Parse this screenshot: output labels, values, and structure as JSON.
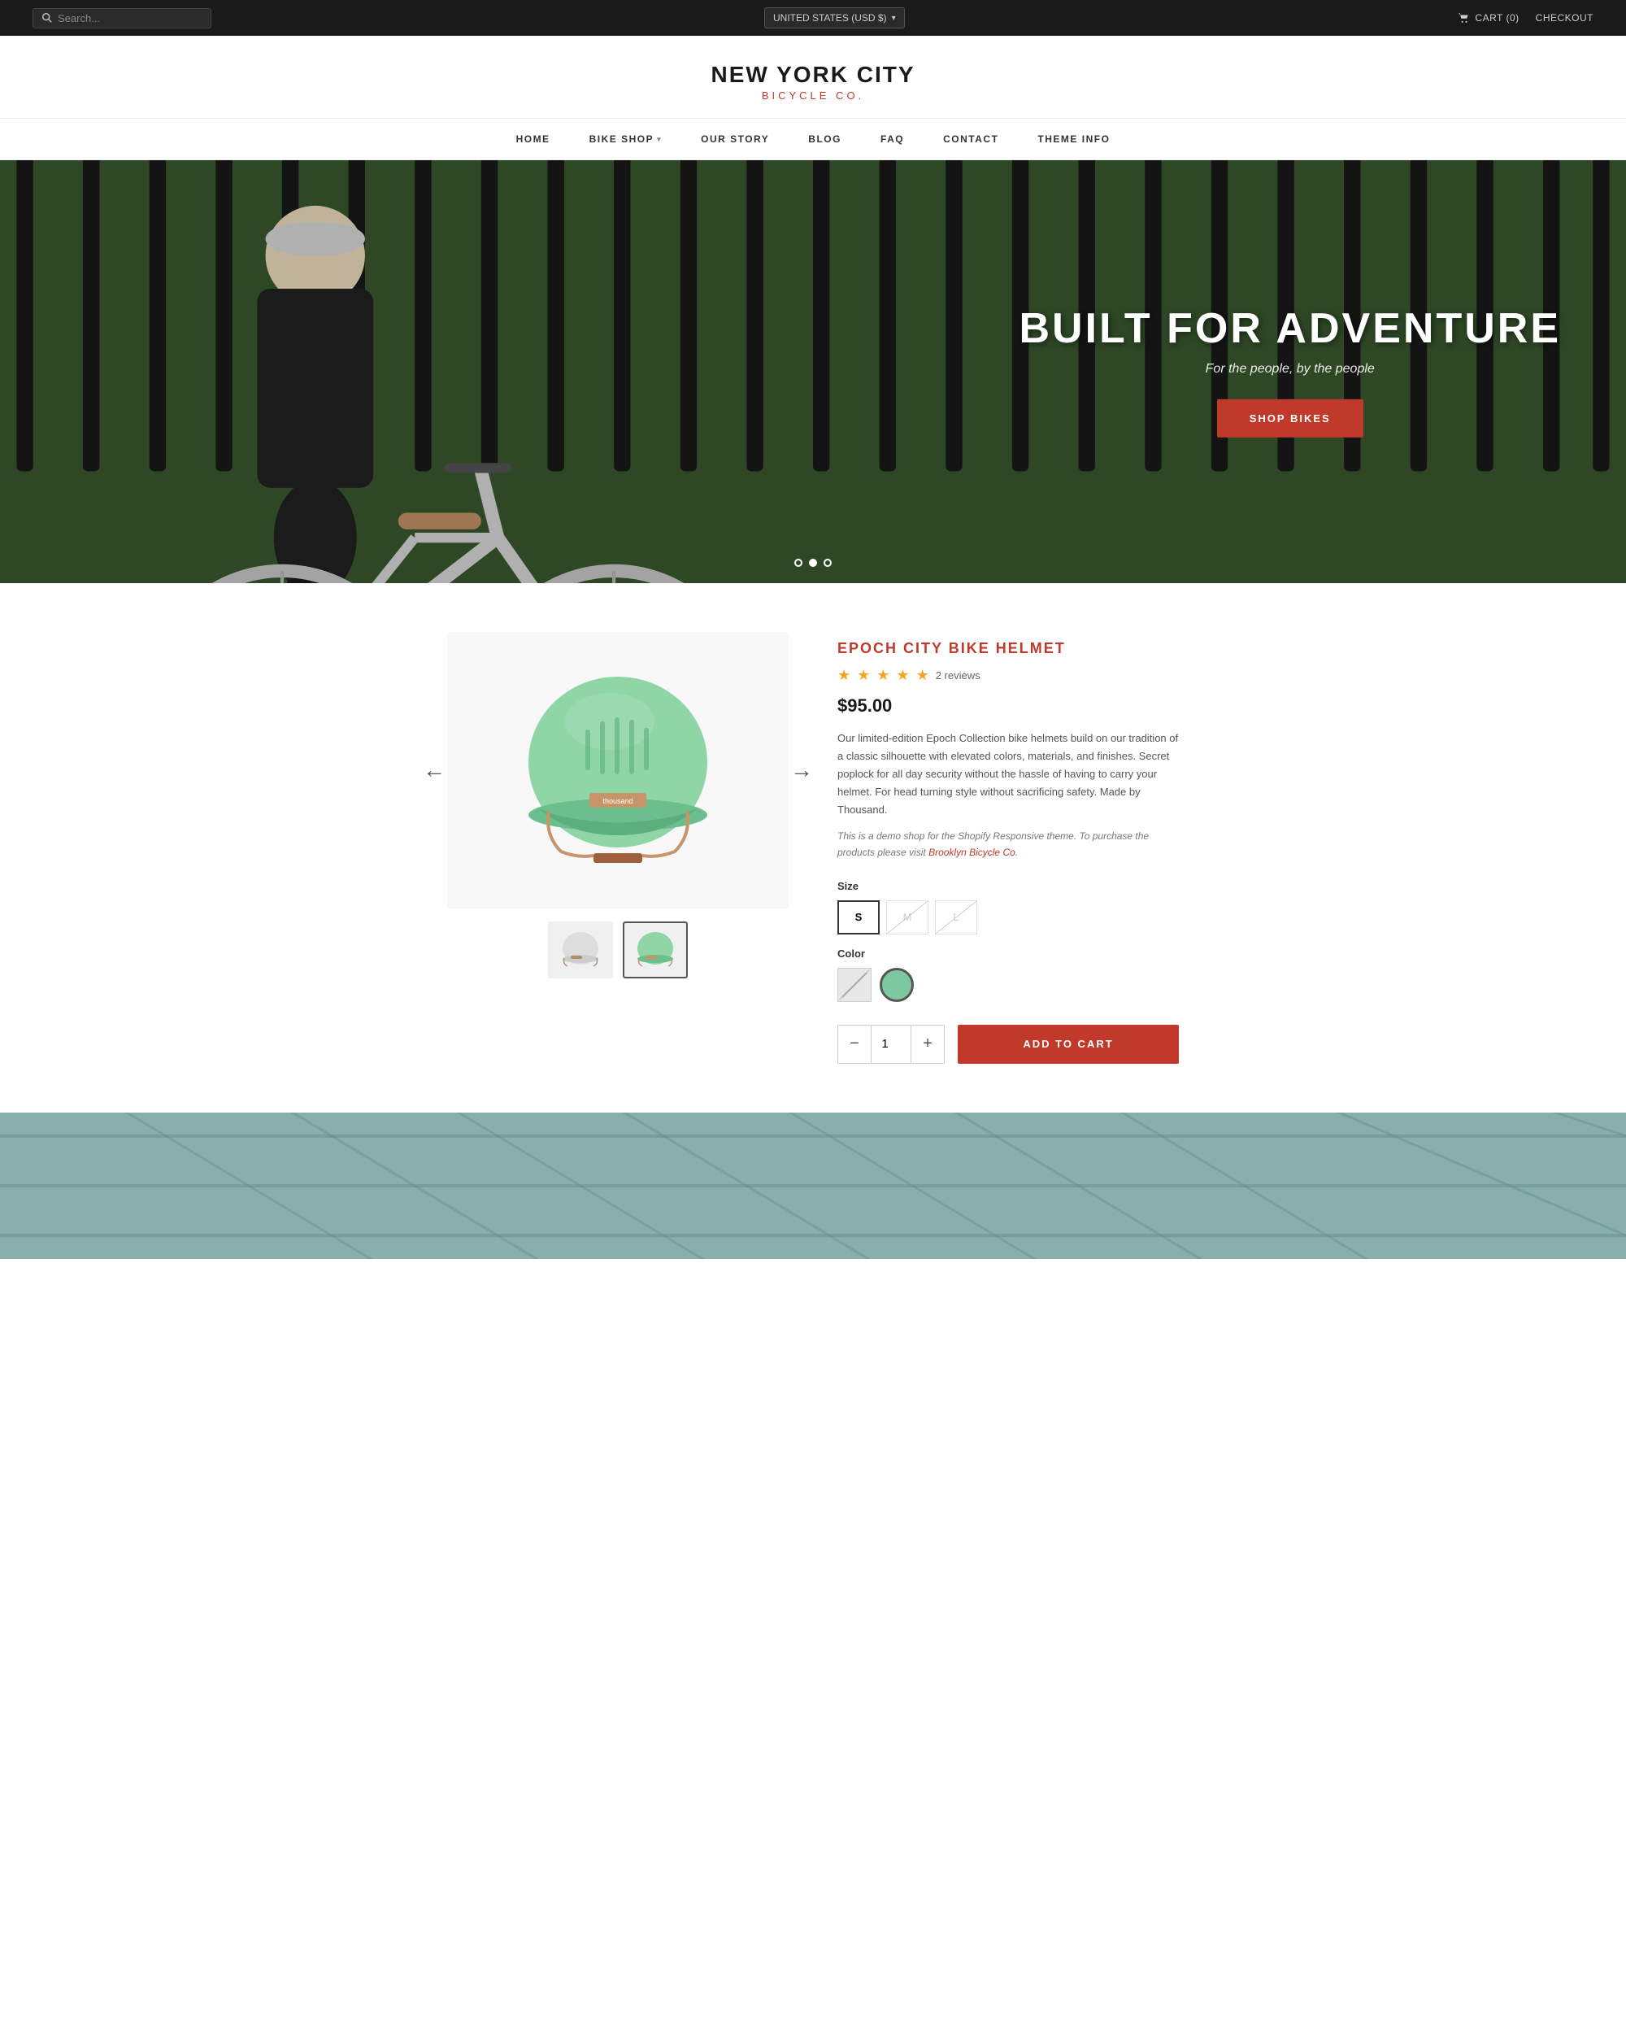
{
  "topbar": {
    "search_placeholder": "Search...",
    "currency": "UNITED STATES (USD $)",
    "cart_label": "CART (0)",
    "checkout_label": "CHECKOUT"
  },
  "header": {
    "brand_name": "NEW YORK CITY",
    "brand_sub": "BICYCLE CO."
  },
  "nav": {
    "items": [
      {
        "label": "HOME",
        "has_dropdown": false
      },
      {
        "label": "BIKE SHOP",
        "has_dropdown": true
      },
      {
        "label": "OUR STORY",
        "has_dropdown": false
      },
      {
        "label": "BLOG",
        "has_dropdown": false
      },
      {
        "label": "FAQ",
        "has_dropdown": false
      },
      {
        "label": "CONTACT",
        "has_dropdown": false
      },
      {
        "label": "THEME INFO",
        "has_dropdown": false
      }
    ]
  },
  "hero": {
    "title": "BUILT FOR ADVENTURE",
    "subtitle": "For the people, by the people",
    "cta_label": "SHOP BIKES",
    "dots": [
      {
        "active": false
      },
      {
        "active": true
      },
      {
        "active": false
      }
    ]
  },
  "product": {
    "name": "EPOCH CITY BIKE HELMET",
    "reviews_count": "2 reviews",
    "price": "$95.00",
    "description": "Our limited-edition Epoch Collection bike helmets build on our tradition of a classic silhouette with elevated colors, materials, and finishes. Secret poplock for all day security without the hassle of having to carry your helmet. For head turning style without sacrificing safety. Made by Thousand.",
    "note_text": "This is a demo shop for the Shopify Responsive theme. To purchase the products please visit",
    "note_link_text": "Brooklyn Bicycle Co.",
    "note_link_url": "#",
    "size_label": "Size",
    "sizes": [
      {
        "label": "S",
        "selected": true,
        "available": true
      },
      {
        "label": "M",
        "selected": false,
        "available": false
      },
      {
        "label": "L",
        "selected": false,
        "available": false
      }
    ],
    "color_label": "Color",
    "colors": [
      {
        "name": "White",
        "available": false,
        "selected": false
      },
      {
        "name": "Mint",
        "available": true,
        "selected": true
      }
    ],
    "qty": 1,
    "add_to_cart_label": "ADD TO CART"
  }
}
